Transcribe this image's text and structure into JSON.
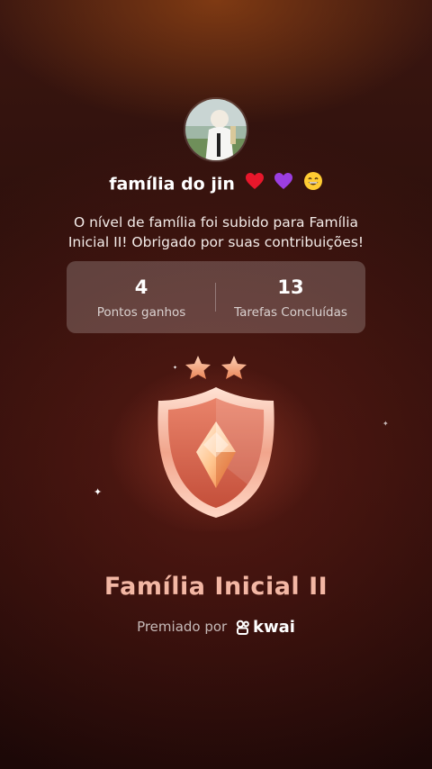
{
  "family": {
    "name": "família do jin",
    "emojis": [
      "red-heart",
      "purple-heart",
      "grinning-face"
    ]
  },
  "message": "O nível de família foi subido para Família Inicial II! Obrigado por suas contribuições!",
  "stats": {
    "points": {
      "value": "4",
      "label": "Pontos ganhos"
    },
    "tasks": {
      "value": "13",
      "label": "Tarefas Concluídas"
    }
  },
  "badge": {
    "stars": 2,
    "level_name": "Família Inicial II"
  },
  "awarded_by": {
    "prefix": "Premiado por",
    "brand": "kwai"
  },
  "colors": {
    "background": "#2a0d0a",
    "level_text": "#f3b7a4",
    "star": "#f2a07a",
    "shield": "#e9836a"
  }
}
